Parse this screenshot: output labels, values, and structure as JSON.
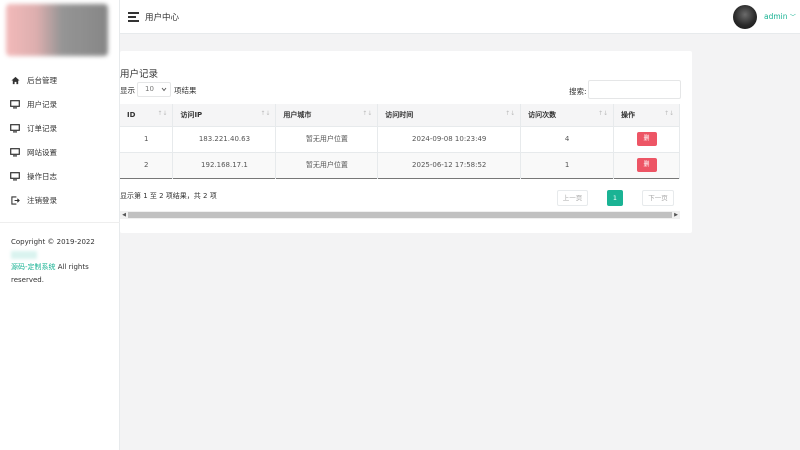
{
  "header": {
    "title": "用户中心",
    "user": "admin",
    "user_caret": "﹀"
  },
  "sidebar": {
    "items": [
      {
        "label": "后台管理",
        "icon": "home-icon"
      },
      {
        "label": "用户记录",
        "icon": "monitor-icon"
      },
      {
        "label": "订单记录",
        "icon": "monitor-icon"
      },
      {
        "label": "网站设置",
        "icon": "monitor-icon"
      },
      {
        "label": "操作日志",
        "icon": "monitor-icon"
      },
      {
        "label": "注销登录",
        "icon": "logout-icon"
      }
    ],
    "copyright_prefix": "Copyright © 2019-2022",
    "copyright_brand": "源码-定制系统",
    "copyright_suffix": "All rights reserved."
  },
  "card": {
    "title": "用户记录",
    "length_prefix": "显示",
    "length_value": "10",
    "length_suffix": "项结果",
    "search_label": "搜索:",
    "search_value": ""
  },
  "table": {
    "columns": [
      "ID",
      "访问IP",
      "用户城市",
      "访问时间",
      "访问次数",
      "操作"
    ],
    "sort_glyph": "↑↓",
    "rows": [
      {
        "id": "1",
        "ip": "183.221.40.63",
        "city": "暂无用户位置",
        "time": "2024-09-08 10:23:49",
        "count": "4",
        "action": "删"
      },
      {
        "id": "2",
        "ip": "192.168.17.1",
        "city": "暂无用户位置",
        "time": "2025-06-12 17:58:52",
        "count": "1",
        "action": "删"
      }
    ]
  },
  "footer": {
    "info": "显示第 1 至 2 项结果，共 2 项",
    "prev": "上一页",
    "page": "1",
    "next": "下一页"
  },
  "colors": {
    "accent": "#1ab394",
    "danger": "#ed5565"
  }
}
